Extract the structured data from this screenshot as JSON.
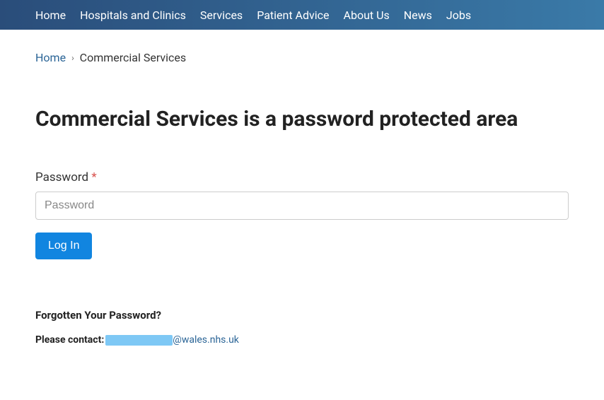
{
  "nav": {
    "items": [
      {
        "label": "Home"
      },
      {
        "label": "Hospitals and Clinics"
      },
      {
        "label": "Services"
      },
      {
        "label": "Patient Advice"
      },
      {
        "label": "About Us"
      },
      {
        "label": "News"
      },
      {
        "label": "Jobs"
      }
    ]
  },
  "breadcrumb": {
    "home": "Home",
    "separator": "›",
    "current": "Commercial Services"
  },
  "page": {
    "title": "Commercial Services is a password protected area"
  },
  "form": {
    "password_label": "Password",
    "required_mark": "*",
    "password_placeholder": "Password",
    "login_button": "Log In"
  },
  "forgotten": {
    "title": "Forgotten Your Password?",
    "contact_label": "Please contact:",
    "email_domain": "@wales.nhs.uk"
  }
}
